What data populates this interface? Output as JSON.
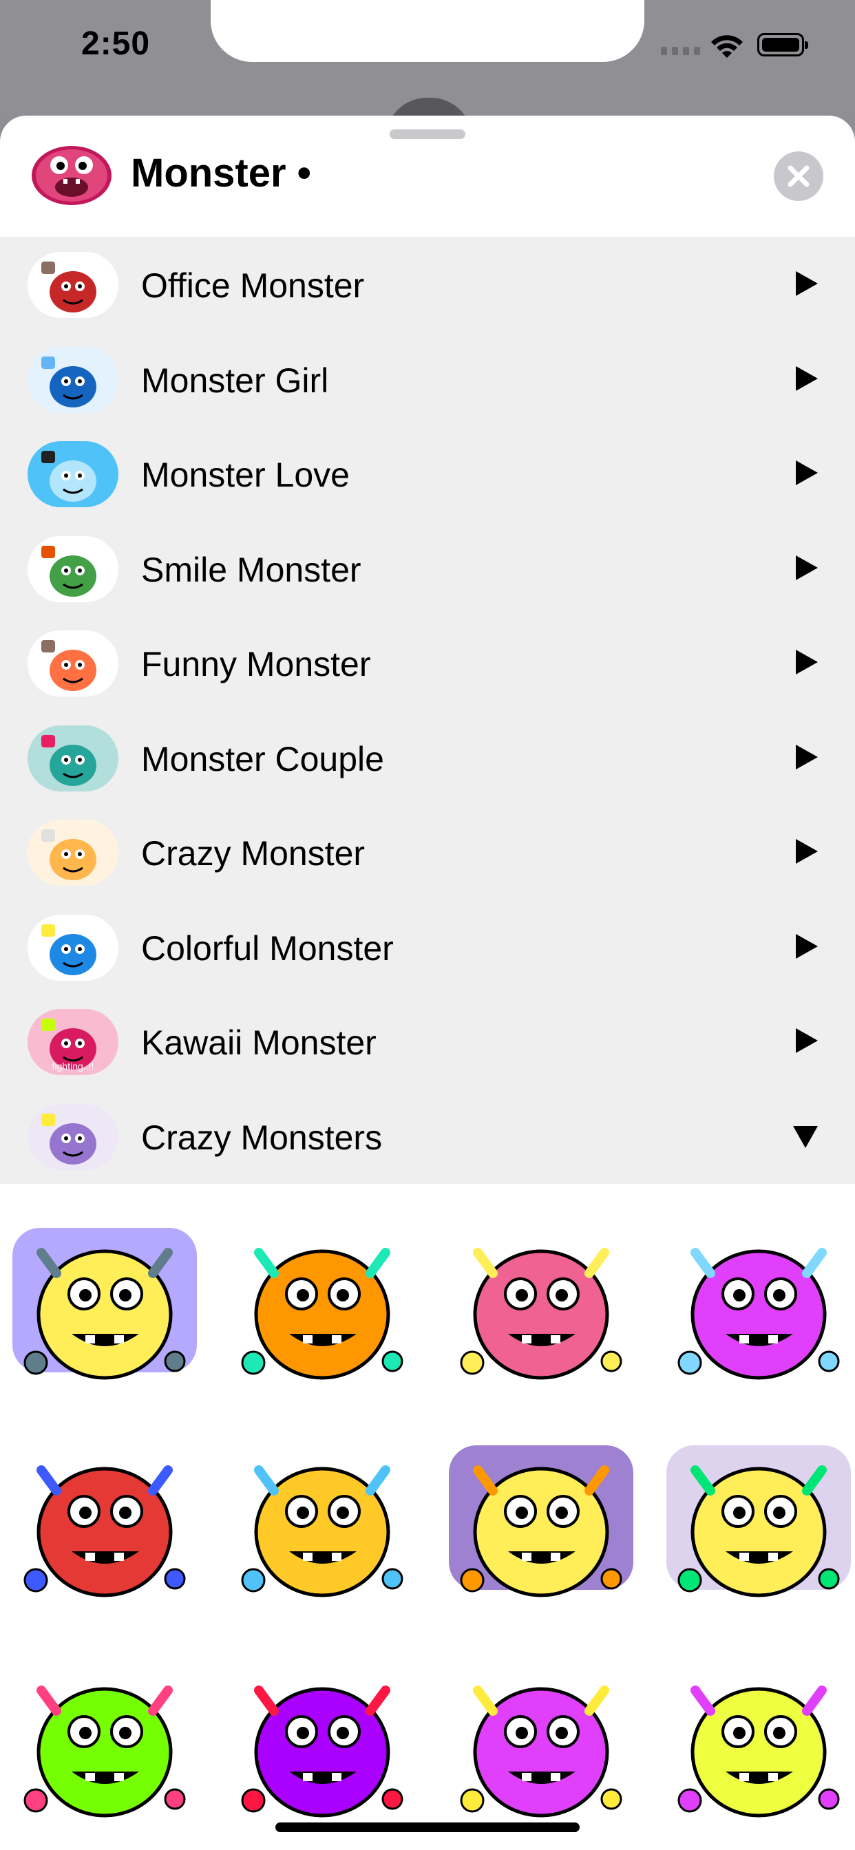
{
  "status": {
    "time": "2:50"
  },
  "header": {
    "title": "Monster •"
  },
  "packs": [
    {
      "label": "Office Monster",
      "thumb": [
        "#fff",
        "#c62828",
        "#8d6e63"
      ],
      "state": "collapsed"
    },
    {
      "label": "Monster Girl",
      "thumb": [
        "#e3f2fd",
        "#1565c0",
        "#64b5f6"
      ],
      "state": "collapsed"
    },
    {
      "label": "Monster Love",
      "thumb": [
        "#4fc3f7",
        "#b3e5fc",
        "#212121"
      ],
      "state": "collapsed"
    },
    {
      "label": "Smile Monster",
      "thumb": [
        "#fff",
        "#43a047",
        "#e65100"
      ],
      "state": "collapsed"
    },
    {
      "label": "Funny Monster",
      "thumb": [
        "#fff",
        "#ff7043",
        "#8d6e63"
      ],
      "state": "collapsed"
    },
    {
      "label": "Monster Couple",
      "thumb": [
        "#b2dfdb",
        "#26a69a",
        "#e91e63"
      ],
      "state": "collapsed"
    },
    {
      "label": "Crazy Monster",
      "thumb": [
        "#fff3e0",
        "#ffb74d",
        "#e0e0e0"
      ],
      "state": "collapsed"
    },
    {
      "label": "Colorful Monster",
      "thumb": [
        "#fff",
        "#1e88e5",
        "#ffeb3b"
      ],
      "state": "collapsed"
    },
    {
      "label": "Kawaii Monster",
      "thumb": [
        "#f8bbd0",
        "#d81b60",
        "#c6ff00"
      ],
      "state": "collapsed"
    },
    {
      "label": "Crazy Monsters",
      "thumb": [
        "#ede7f6",
        "#9575cd",
        "#ffeb3b"
      ],
      "state": "expanded"
    }
  ],
  "thumb_text": {
    "kawaii": "fighting..!!"
  },
  "stickers": [
    {
      "name": "ufo-sticker",
      "bg": "#9b8cff",
      "body": "#ffee58",
      "accent": "#607d8b"
    },
    {
      "name": "two-monsters-dancing-sticker",
      "bg": "#ffffff",
      "body": "#ff9800",
      "accent": "#1de9b6"
    },
    {
      "name": "pink-monster-vacuum-sticker",
      "bg": "#ffffff",
      "body": "#f06292",
      "accent": "#ffee58"
    },
    {
      "name": "monster-computer-sticker",
      "bg": "#ffffff",
      "body": "#e040fb",
      "accent": "#80d8ff"
    },
    {
      "name": "angry-red-cyclops-sticker",
      "bg": "#ffffff",
      "body": "#e53935",
      "accent": "#3d5afe"
    },
    {
      "name": "shower-monster-sticker",
      "bg": "#ffffff",
      "body": "#ffca28",
      "accent": "#4fc3f7"
    },
    {
      "name": "sunset-monster-sticker",
      "bg": "#7e57c2",
      "body": "#ffee58",
      "accent": "#ff9800"
    },
    {
      "name": "monsters-in-ufo-sticker",
      "bg": "#d1c4e9",
      "body": "#ffee58",
      "accent": "#00e676"
    },
    {
      "name": "phone-monster-sticker",
      "bg": "#ffffff",
      "body": "#76ff03",
      "accent": "#ff4081"
    },
    {
      "name": "purple-alarm-monster-sticker",
      "bg": "#ffffff",
      "body": "#aa00ff",
      "accent": "#ff1744"
    },
    {
      "name": "pink-dragon-sticker",
      "bg": "#ffffff",
      "body": "#e040fb",
      "accent": "#ffeb3b"
    },
    {
      "name": "three-faces-monster-sticker",
      "bg": "#ffffff",
      "body": "#eeff41",
      "accent": "#e040fb"
    }
  ]
}
